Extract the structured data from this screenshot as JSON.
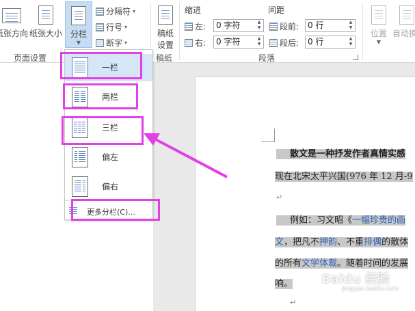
{
  "ribbon": {
    "orientation_label": "纸张方向",
    "size_label": "纸张大小",
    "columns_label": "分栏",
    "breaks_label": "分隔符",
    "line_numbers_label": "行号",
    "hyphenation_label": "断字",
    "group_page_setup": "页面设置",
    "manuscript_label_1": "稿纸",
    "manuscript_label_2": "设置",
    "group_manuscript": "稿纸",
    "indent_header": "缩进",
    "spacing_header": "间距",
    "indent_left_label": "左:",
    "indent_left_value": "0 字符",
    "indent_right_label": "右:",
    "indent_right_value": "0 字符",
    "spacing_before_label": "段前:",
    "spacing_before_value": "0 行",
    "spacing_after_label": "段后:",
    "spacing_after_value": "0 行",
    "group_paragraph": "段落",
    "position_label": "位置",
    "wrap_text_label": "自动换"
  },
  "dropdown": {
    "items": [
      {
        "label": "一栏"
      },
      {
        "label": "两栏"
      },
      {
        "label": "三栏"
      },
      {
        "label": "偏左"
      },
      {
        "label": "偏右"
      }
    ],
    "more_label": "更多分栏(C)..."
  },
  "document": {
    "line1": "散文是一种抒发作者真情实感",
    "line2": "现在北宋太平兴国(976 年 12 月-9",
    "line3_prefix": "例如：习文昭《",
    "line3_link": "一幅珍贵的画",
    "line4_a": "文",
    "line4_b": "，把凡不",
    "line4_c": "押韵",
    "line4_d": "、不重",
    "line4_e": "排偶",
    "line4_f": "的散体",
    "line5_a": "的所有",
    "line5_b": "文学体裁",
    "line5_c": "。随着时间的发展",
    "line6": "响。",
    "watermark": "Baidu 经验",
    "watermark_url": "jingyan.baidu.com"
  },
  "colors": {
    "highlight": "#e040e6",
    "selection": "#c8c8c8",
    "link": "#2b5fb0"
  }
}
